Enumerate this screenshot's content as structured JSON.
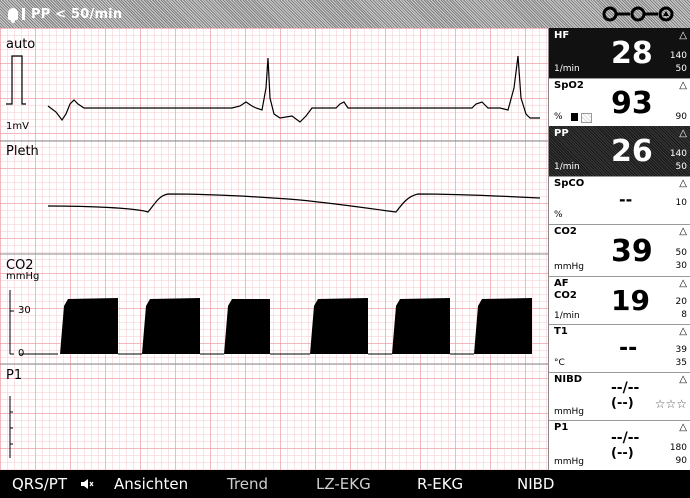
{
  "alarm": {
    "message": "PP < 50/min"
  },
  "waves": {
    "ecg": {
      "label": "auto",
      "scale": "1mV"
    },
    "pleth": {
      "label": "Pleth"
    },
    "co2": {
      "label": "CO2",
      "unit": "mmHg",
      "tick_high": "30",
      "tick_low": "0"
    },
    "p1": {
      "label": "P1"
    }
  },
  "params": {
    "hf": {
      "label": "HF",
      "value": "28",
      "unit": "1/min",
      "limit_high": "140",
      "limit_low": "50"
    },
    "spo2": {
      "label": "SpO2",
      "value": "93",
      "unit": "%",
      "limit_high": "",
      "limit_low": "90"
    },
    "pp": {
      "label": "PP",
      "value": "26",
      "unit": "1/min",
      "limit_high": "140",
      "limit_low": "50"
    },
    "spco": {
      "label": "SpCO",
      "value": "--",
      "unit": "%",
      "limit_high": "10",
      "limit_low": ""
    },
    "co2": {
      "label": "CO2",
      "value": "39",
      "unit": "mmHg",
      "limit_high": "50",
      "limit_low": "30"
    },
    "af": {
      "label": "AF",
      "label2": "CO2",
      "value": "19",
      "unit": "1/min",
      "limit_high": "20",
      "limit_low": "8"
    },
    "t1": {
      "label": "T1",
      "value": "--",
      "unit": "°C",
      "limit_high": "39",
      "limit_low": "35"
    },
    "nibd": {
      "label": "NIBD",
      "value": "--/--",
      "value2": "(--)",
      "unit": "mmHg",
      "stars": "☆☆☆"
    },
    "p1": {
      "label": "P1",
      "value": "--/--",
      "value2": "(--)",
      "unit": "mmHg",
      "limit_high": "180",
      "limit_low": "90"
    },
    "bell_symbol": "△"
  },
  "menu": {
    "qrs": "QRS/PT",
    "views": "Ansichten",
    "trend": "Trend",
    "lz_ekg": "LZ-EKG",
    "r_ekg": "R-EKG",
    "nibd": "NIBD"
  },
  "colors": {
    "grid_major": "#ec96a0",
    "grid_minor": "#f4c8ce",
    "bar": "#000000"
  }
}
